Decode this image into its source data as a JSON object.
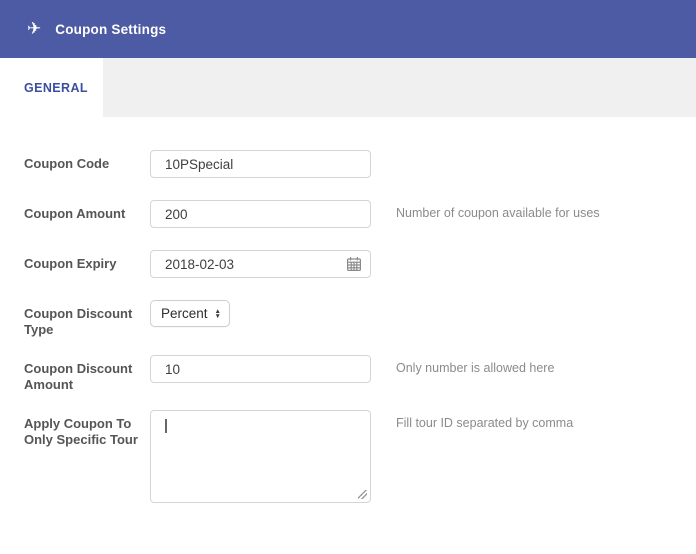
{
  "header": {
    "title": "Coupon Settings",
    "icon": "plane",
    "background_color": "#4d5aa4",
    "text_color": "#ffffff"
  },
  "tabs": [
    {
      "label": "GENERAL",
      "active": true
    }
  ],
  "colors": {
    "tab_bar_background": "#f0f0f0",
    "tab_active_text": "#3b4fa2",
    "label_text": "#555555",
    "input_border": "#d5d5d5",
    "helper_text": "#8b8b8b"
  },
  "form": {
    "fields": [
      {
        "label": "Coupon Code",
        "type": "text",
        "value": "10PSpecial",
        "helper": ""
      },
      {
        "label": "Coupon Amount",
        "type": "text",
        "value": "200",
        "helper": "Number of coupon available for uses"
      },
      {
        "label": "Coupon Expiry",
        "type": "date",
        "value": "2018-02-03",
        "icon": "calendar",
        "helper": ""
      },
      {
        "label": "Coupon Discount Type",
        "type": "select",
        "value": "Percent",
        "helper": ""
      },
      {
        "label": "Coupon Discount Amount",
        "type": "text",
        "value": "10",
        "helper": "Only number is allowed here"
      },
      {
        "label": "Apply Coupon To Only Specific Tour",
        "type": "textarea",
        "value": "",
        "helper": "Fill tour ID separated by comma"
      }
    ],
    "stepper_up": "▲",
    "stepper_down": "▼"
  }
}
